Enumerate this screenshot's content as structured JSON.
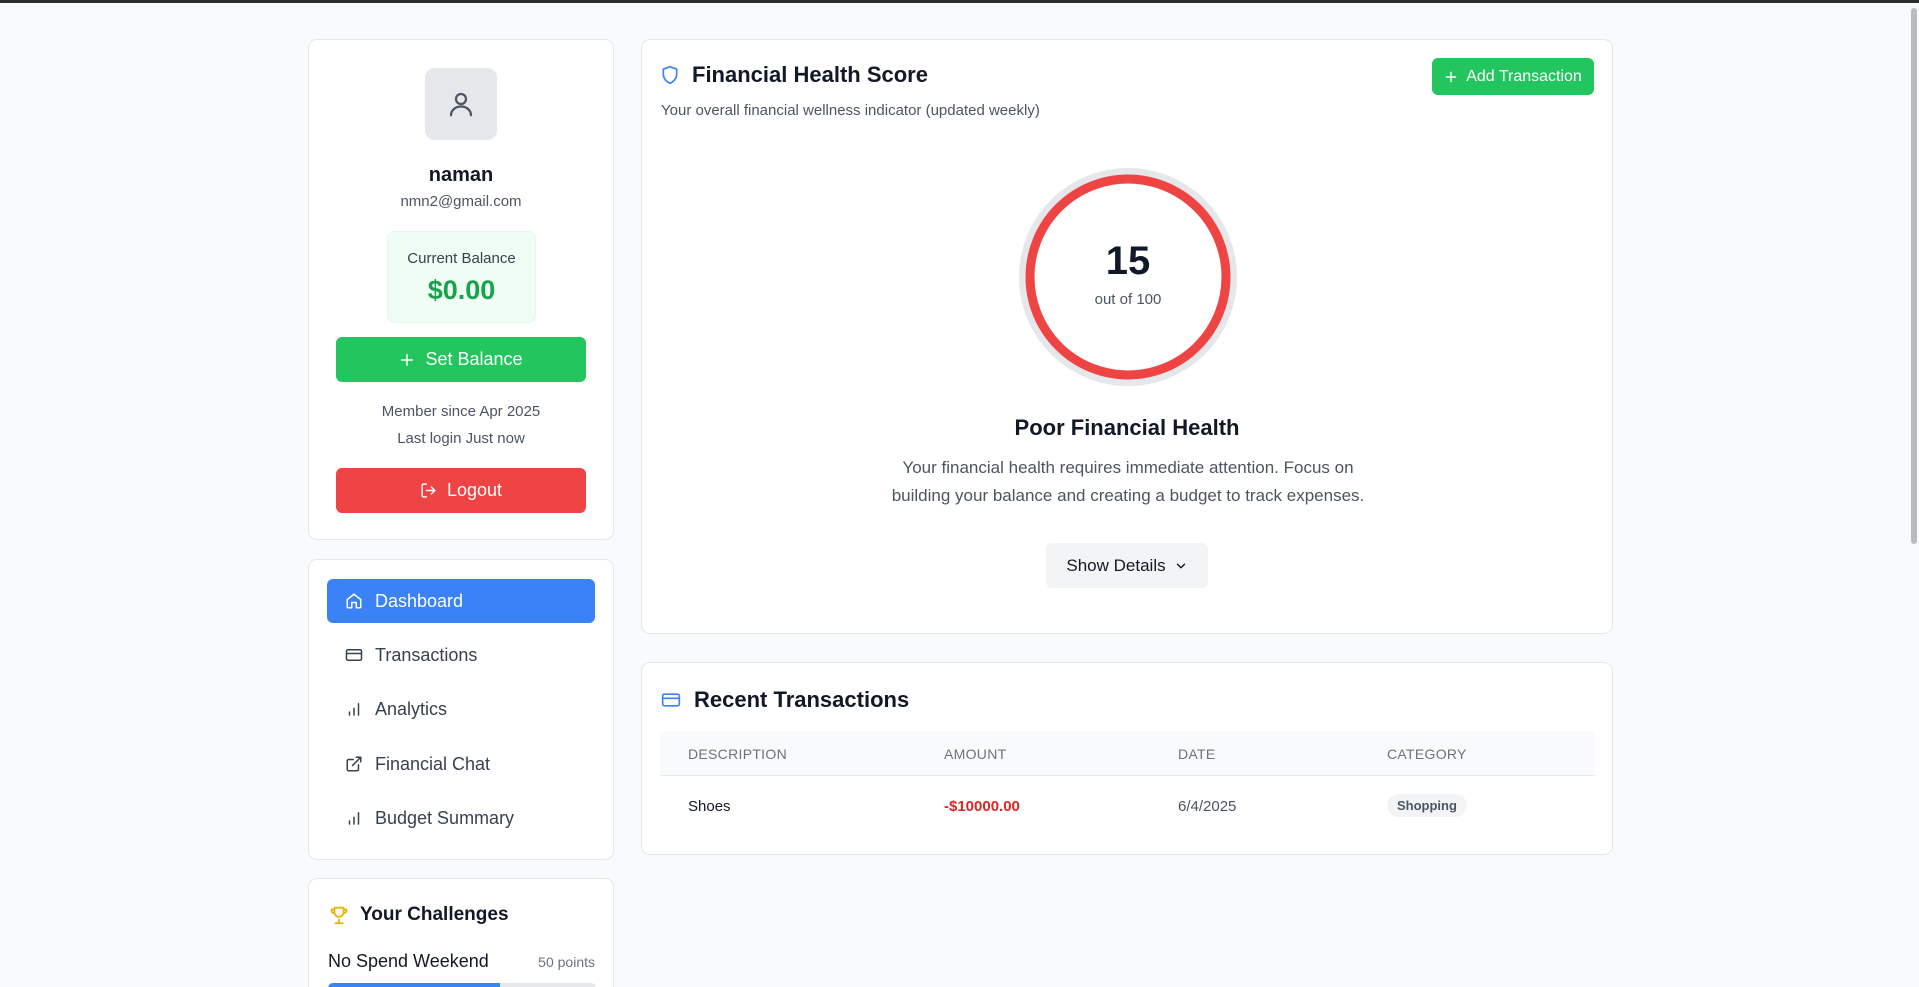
{
  "profile": {
    "name": "naman",
    "email": "nmn2@gmail.com",
    "balance_label": "Current Balance",
    "balance_value": "$0.00",
    "set_balance_label": "Set Balance",
    "member_since": "Member since Apr 2025",
    "last_login": "Last login Just now",
    "logout_label": "Logout"
  },
  "nav": {
    "items": [
      {
        "label": "Dashboard",
        "icon": "home-icon",
        "active": true
      },
      {
        "label": "Transactions",
        "icon": "credit-card-icon"
      },
      {
        "label": "Analytics",
        "icon": "bar-chart-icon"
      },
      {
        "label": "Financial Chat",
        "icon": "external-link-icon"
      },
      {
        "label": "Budget Summary",
        "icon": "bar-chart-icon"
      }
    ]
  },
  "challenges": {
    "title": "Your Challenges",
    "items": [
      {
        "name": "No Spend Weekend",
        "points": "50 points",
        "progress": 0.64
      }
    ]
  },
  "health": {
    "title": "Financial Health Score",
    "subtitle": "Your overall financial wellness indicator (updated weekly)",
    "add_transaction_label": "Add Transaction",
    "score": "15",
    "score_value": 15,
    "score_max": 100,
    "score_suffix": "out of 100",
    "status": "Poor Financial Health",
    "description": "Your financial health requires immediate attention. Focus on building your balance and creating a budget to track expenses.",
    "show_details_label": "Show Details",
    "gauge_color": "#ef4444"
  },
  "transactions": {
    "title": "Recent Transactions",
    "columns": [
      "DESCRIPTION",
      "AMOUNT",
      "DATE",
      "CATEGORY"
    ],
    "rows": [
      {
        "description": "Shoes",
        "amount": "-$10000.00",
        "date": "6/4/2025",
        "category": "Shopping"
      }
    ]
  },
  "colors": {
    "primary": "#3b82f6",
    "success": "#22c55e",
    "danger": "#ef4444"
  }
}
